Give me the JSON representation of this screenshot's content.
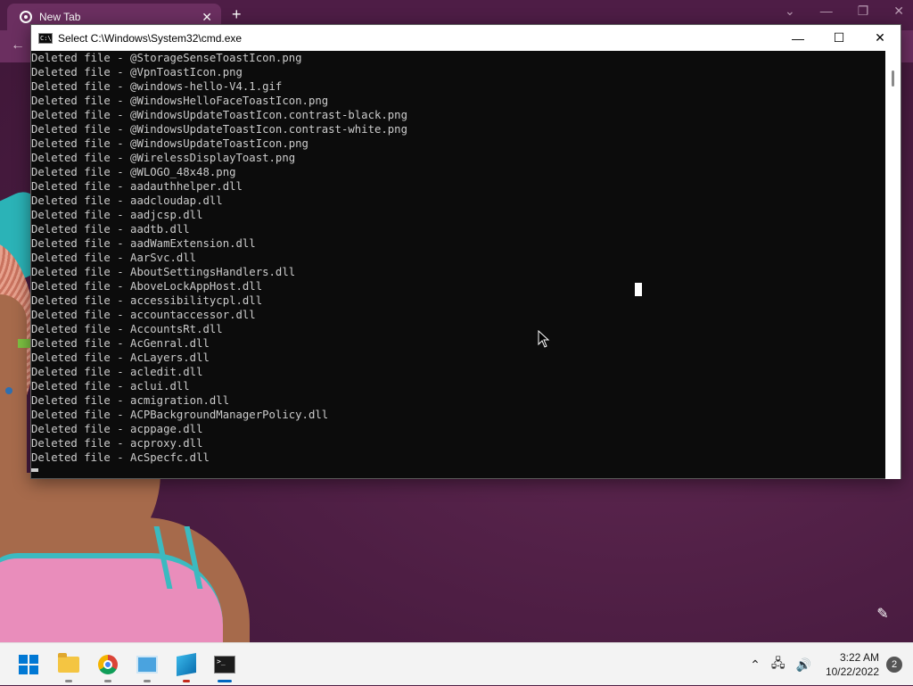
{
  "browser": {
    "tab_title": "New Tab",
    "tab_close_symbol": "✕",
    "new_tab_symbol": "+",
    "window_controls": [
      "⌄",
      "—",
      "❐",
      "✕"
    ]
  },
  "cmd": {
    "title": "Select C:\\Windows\\System32\\cmd.exe",
    "controls": {
      "minimize": "—",
      "maximize": "☐",
      "close": "✕"
    },
    "lines": [
      "Deleted file - @StorageSenseToastIcon.png",
      "Deleted file - @VpnToastIcon.png",
      "Deleted file - @windows-hello-V4.1.gif",
      "Deleted file - @WindowsHelloFaceToastIcon.png",
      "Deleted file - @WindowsUpdateToastIcon.contrast-black.png",
      "Deleted file - @WindowsUpdateToastIcon.contrast-white.png",
      "Deleted file - @WindowsUpdateToastIcon.png",
      "Deleted file - @WirelessDisplayToast.png",
      "Deleted file - @WLOGO_48x48.png",
      "Deleted file - aadauthhelper.dll",
      "Deleted file - aadcloudap.dll",
      "Deleted file - aadjcsp.dll",
      "Deleted file - aadtb.dll",
      "Deleted file - aadWamExtension.dll",
      "Deleted file - AarSvc.dll",
      "Deleted file - AboutSettingsHandlers.dll",
      "Deleted file - AboveLockAppHost.dll",
      "Deleted file - accessibilitycpl.dll",
      "Deleted file - accountaccessor.dll",
      "Deleted file - AccountsRt.dll",
      "Deleted file - AcGenral.dll",
      "Deleted file - AcLayers.dll",
      "Deleted file - acledit.dll",
      "Deleted file - aclui.dll",
      "Deleted file - acmigration.dll",
      "Deleted file - ACPBackgroundManagerPolicy.dll",
      "Deleted file - acppage.dll",
      "Deleted file - acproxy.dll",
      "Deleted file - AcSpecfc.dll"
    ]
  },
  "taskbar": {
    "apps": [
      {
        "name": "start",
        "icon": "windows-start-icon"
      },
      {
        "name": "file-explorer",
        "icon": "folder-icon"
      },
      {
        "name": "chrome",
        "icon": "chrome-icon"
      },
      {
        "name": "control-panel",
        "icon": "control-panel-icon"
      },
      {
        "name": "registry-editor",
        "icon": "registry-icon"
      },
      {
        "name": "command-prompt",
        "icon": "cmd-icon"
      }
    ],
    "tray": {
      "chevron": "⌃",
      "time": "3:22 AM",
      "date": "10/22/2022",
      "notification_count": "2"
    }
  },
  "colors": {
    "accent": "#0067c0",
    "terminal_bg": "#0c0c0c",
    "terminal_fg": "#cccccc",
    "wallpaper": "#4f1f44"
  }
}
